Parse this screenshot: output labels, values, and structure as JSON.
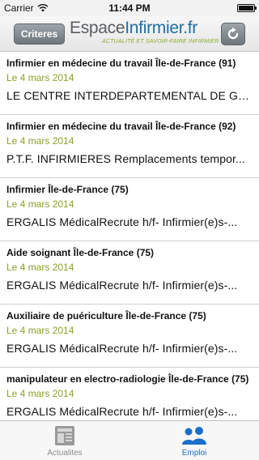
{
  "status_bar": {
    "carrier": "Carrier",
    "time": "11:44 PM",
    "battery_level": 1.0
  },
  "header": {
    "criteres_label": "Criteres",
    "logo_espace": "Espace",
    "logo_infirmier": "Infirmier.fr",
    "logo_tagline": "ACTUALITÉ ET SAVOIR-FAIRE INFIRMIER"
  },
  "jobs": [
    {
      "title": "Infirmier en médecine du travail Île-de-France (91)",
      "date": "Le 4 mars 2014",
      "company": "LE CENTRE INTERDEPARTEMENTAL DE GE..."
    },
    {
      "title": "Infirmier en médecine du travail Île-de-France (92)",
      "date": "Le 4 mars 2014",
      "company": "P.T.F. INFIRMIERES Remplacements tempor..."
    },
    {
      "title": "Infirmier Île-de-France (75)",
      "date": "Le 4 mars 2014",
      "company": "ERGALIS MédicalRecrute h/f- Infirmier(e)s-..."
    },
    {
      "title": "Aide soignant Île-de-France (75)",
      "date": "Le 4 mars 2014",
      "company": "ERGALIS MédicalRecrute h/f- Infirmier(e)s-..."
    },
    {
      "title": "Auxiliaire de puériculture Île-de-France (75)",
      "date": "Le 4 mars 2014",
      "company": "ERGALIS MédicalRecrute h/f- Infirmier(e)s-..."
    },
    {
      "title": "manipulateur en electro-radiologie Île-de-France (75)",
      "date": "Le 4 mars 2014",
      "company": "ERGALIS MédicalRecrute h/f- Infirmier(e)s-..."
    }
  ],
  "tabs": [
    {
      "label": "Actualites",
      "icon": "newspaper-icon",
      "active": false
    },
    {
      "label": "Emploi",
      "icon": "people-icon",
      "active": true
    }
  ],
  "colors": {
    "accent_green": "#8aa02a",
    "active_tab": "#1a6fc9",
    "logo_blue": "#1f6ea3"
  }
}
